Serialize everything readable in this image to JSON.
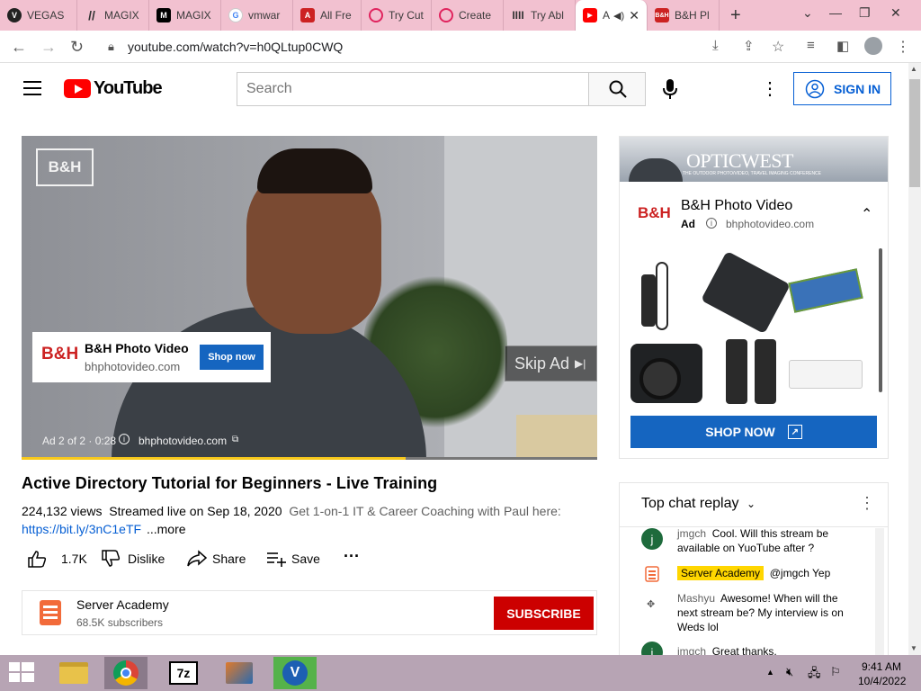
{
  "browser": {
    "tabs": [
      {
        "label": "VEGAS",
        "icon": "vegas-icon",
        "color": "#222222"
      },
      {
        "label": "MAGIX",
        "icon": "magix-icon",
        "color": "#333333"
      },
      {
        "label": "MAGIX",
        "icon": "magix-m-icon",
        "color": "#000000"
      },
      {
        "label": "vmwar",
        "icon": "google-icon",
        "color": "#4285f4"
      },
      {
        "label": "All Fre",
        "icon": "adobe-icon",
        "color": "#cc2222"
      },
      {
        "label": "Try Cut",
        "icon": "clock-icon",
        "color": "#e0245e"
      },
      {
        "label": "Create",
        "icon": "clock-icon",
        "color": "#e0245e"
      },
      {
        "label": "Try Abl",
        "icon": "bars-icon",
        "color": "#333333"
      },
      {
        "label": "A",
        "icon": "youtube-icon",
        "color": "#ff0000"
      },
      {
        "label": "B&H Pl",
        "icon": "bh-icon",
        "color": "#cc2222"
      }
    ],
    "url": "youtube.com/watch?v=h0QLtup0CWQ"
  },
  "youtube": {
    "logo_text": "YouTube",
    "search_placeholder": "Search",
    "signin_label": "SIGN IN"
  },
  "video_ad": {
    "overlay_brand": "B&H Photo Video",
    "overlay_domain": "bhphotovideo.com",
    "shop_label": "Shop now",
    "skip_label": "Skip Ad",
    "ad_status": "Ad 2 of 2 · 0:28",
    "ad_domain": "bhphotovideo.com",
    "watermark": "B&H",
    "progress": 0.667
  },
  "video": {
    "title": "Active Directory Tutorial for Beginners - Live Training",
    "views": "224,132 views",
    "streamed": "Streamed live on Sep 18, 2020",
    "description": "Get 1-on-1 IT & Career Coaching with Paul here:",
    "link": "https://bit.ly/3nC1eTF",
    "more": "...more",
    "likes": "1.7K",
    "dislike": "Dislike",
    "share": "Share",
    "save": "Save"
  },
  "channel": {
    "name": "Server Academy",
    "subscribers": "68.5K subscribers",
    "subscribe_label": "SUBSCRIBE"
  },
  "side_ad": {
    "banner_text": "OPTICWEST",
    "banner_sub": "THE OUTDOOR PHOTO/VIDEO, TRAVEL IMAGING CONFERENCE",
    "brand": "B&H Photo Video",
    "ad_label": "Ad",
    "domain": "bhphotovideo.com",
    "cta": "SHOP NOW"
  },
  "chat": {
    "header": "Top chat replay",
    "messages": [
      {
        "author": "jmgch",
        "text": "Cool. Will this stream be available on YuoTube after ?",
        "avatar": "j"
      },
      {
        "author": "Server Academy",
        "text": "@jmgch Yep",
        "avatar": "sa"
      },
      {
        "author": "Mashyu",
        "text": "Awesome! When will the next stream be? My interview is on Weds lol",
        "avatar": "m"
      },
      {
        "author": "jmgch",
        "text": "Great thanks.",
        "avatar": "j"
      }
    ]
  },
  "taskbar": {
    "time": "9:41 AM",
    "date": "10/4/2022"
  },
  "colors": {
    "tabstrip": "#f2c1d0",
    "youtube_red": "#ff0000",
    "link_blue": "#065fd4",
    "shop_blue": "#1565c0",
    "subscribe_red": "#cc0000",
    "taskbar": "#b7a4b4",
    "chat_highlight": "#ffd600"
  }
}
